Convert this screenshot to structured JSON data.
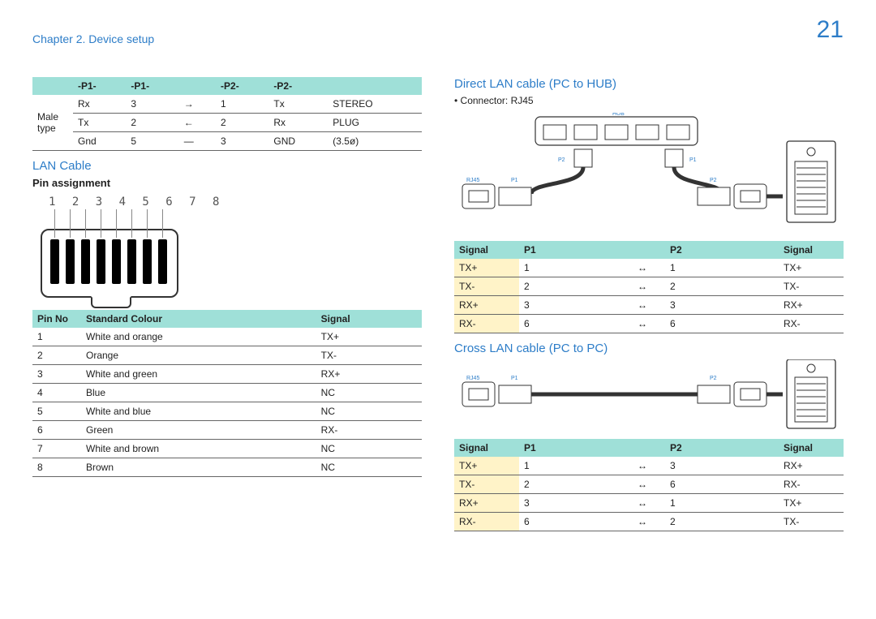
{
  "page_number": "21",
  "chapter": "Chapter 2. Device setup",
  "left": {
    "top_table": {
      "headers": [
        "-P1-",
        "-P1-",
        "",
        "-P2-",
        "-P2-",
        ""
      ],
      "rowlabel": "Male type",
      "rows": [
        [
          "Rx",
          "3",
          "→",
          "1",
          "Tx",
          "STEREO"
        ],
        [
          "Tx",
          "2",
          "←",
          "2",
          "Rx",
          "PLUG"
        ],
        [
          "Gnd",
          "5",
          "—",
          "3",
          "GND",
          "(3.5ø)"
        ]
      ]
    },
    "lan_title": "LAN Cable",
    "pin_assign": "Pin assignment",
    "pin_nums": "1 2 3 4 5 6 7 8",
    "pin_table": {
      "headers": [
        "Pin No",
        "Standard Colour",
        "Signal"
      ],
      "rows": [
        [
          "1",
          "White and orange",
          "TX+"
        ],
        [
          "2",
          "Orange",
          "TX-"
        ],
        [
          "3",
          "White and green",
          "RX+"
        ],
        [
          "4",
          "Blue",
          "NC"
        ],
        [
          "5",
          "White and blue",
          "NC"
        ],
        [
          "6",
          "Green",
          "RX-"
        ],
        [
          "7",
          "White and brown",
          "NC"
        ],
        [
          "8",
          "Brown",
          "NC"
        ]
      ]
    }
  },
  "right": {
    "direct_title": "Direct LAN cable (PC to HUB)",
    "connector_label": "• Connector: RJ45",
    "diagram_labels": {
      "hub": "HUB",
      "rj45": "RJ45",
      "p1": "P1",
      "p2": "P2"
    },
    "direct_table": {
      "headers": [
        "Signal",
        "P1",
        "",
        "P2",
        "Signal"
      ],
      "rows": [
        [
          "TX+",
          "1",
          "↔",
          "1",
          "TX+"
        ],
        [
          "TX-",
          "2",
          "↔",
          "2",
          "TX-"
        ],
        [
          "RX+",
          "3",
          "↔",
          "3",
          "RX+"
        ],
        [
          "RX-",
          "6",
          "↔",
          "6",
          "RX-"
        ]
      ]
    },
    "cross_title": "Cross LAN cable (PC to PC)",
    "cross_table": {
      "headers": [
        "Signal",
        "P1",
        "",
        "P2",
        "Signal"
      ],
      "rows": [
        [
          "TX+",
          "1",
          "↔",
          "3",
          "RX+"
        ],
        [
          "TX-",
          "2",
          "↔",
          "6",
          "RX-"
        ],
        [
          "RX+",
          "3",
          "↔",
          "1",
          "TX+"
        ],
        [
          "RX-",
          "6",
          "↔",
          "2",
          "TX-"
        ]
      ]
    }
  }
}
